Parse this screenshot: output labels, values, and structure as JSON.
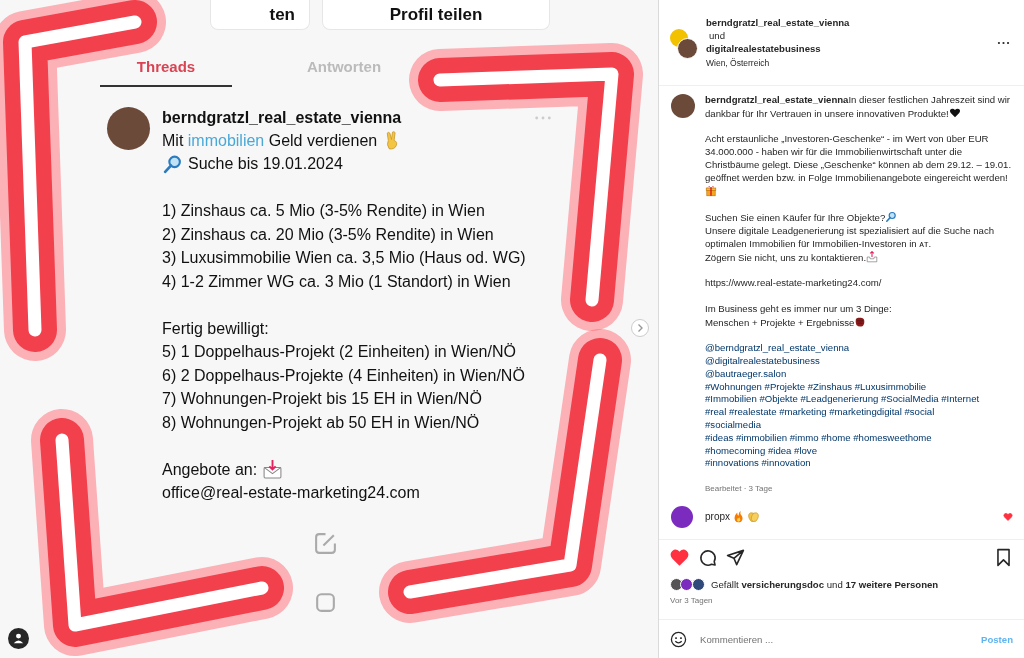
{
  "post_image": {
    "top_buttons": [
      {
        "label": "ten"
      },
      {
        "label": "Profil teilen"
      }
    ],
    "tabs": [
      {
        "label": "Threads",
        "selected": true
      },
      {
        "label": "Antworten",
        "selected": false
      }
    ],
    "thread": {
      "username": "berndgratzl_real_estate_vienna",
      "paragraphs": [
        [
          {
            "before": "Mit ",
            "link": "immobilien",
            "after": " Geld verdienen"
          },
          {
            "text": "Suche bis 19.01.2024"
          }
        ],
        [
          {
            "text": "1) Zinshaus ca. 5 Mio (3-5% Rendite) in Wien"
          },
          {
            "text": "2) Zinshaus ca. 20 Mio (3-5% Rendite) in Wien"
          },
          {
            "text": "3) Luxusimmobilie Wien ca. 3,5 Mio (Haus od. WG)"
          },
          {
            "text": "4) 1-2 Zimmer WG ca. 3 Mio (1 Standort) in Wien"
          }
        ],
        [
          {
            "text": "Fertig bewilligt:"
          },
          {
            "text": "5) 1 Doppelhaus-Projekt (2 Einheiten) in Wien/NÖ"
          },
          {
            "text": "6) 2 Doppelhaus-Projekte (4 Einheiten) in Wien/NÖ"
          },
          {
            "text": "7) Wohnungen-Projekt bis 15 EH in Wien/NÖ"
          },
          {
            "text": "8) Wohnungen-Projekt ab 50 EH in Wien/NÖ"
          }
        ],
        [
          {
            "text": "Angebote an:"
          },
          {
            "text": "office@real-estate-marketing24.com"
          }
        ]
      ]
    }
  },
  "header": {
    "accounts": [
      "berndgratzl_real_estate_vienna",
      "digitalrealestatebusiness"
    ],
    "joiner": "und",
    "location": "Wien, Österreich"
  },
  "caption": {
    "username": "berndgratzl_real_estate_vienna",
    "blocks": [
      [
        {
          "text": "In dieser festlichen Jahreszeit sind wir dankbar für Ihr Vertrauen in unsere innovativen Produkte!",
          "kind": "text"
        }
      ],
      [
        {
          "text": "Acht erstaunliche „Investoren-Geschenke“ - im Wert von über EUR 34.000.000 - haben wir für die Immobilienwirtschaft unter die Christbäume gelegt. Diese „Geschenke“ können ab dem 29.12. – 19.01. geöffnet werden bzw. in Folge Immobilienangebote eingereicht werden!",
          "kind": "text"
        }
      ],
      [
        {
          "text": "Suchen Sie einen Käufer für Ihre Objekte?",
          "kind": "text"
        },
        {
          "text": "Unsere digitale Leadgenerierung ist spezialisiert auf die Suche nach optimalen Immobilien für Immobilien-Investoren in ᴀᴛ.",
          "kind": "text"
        },
        {
          "text": "Zögern Sie nicht, uns zu kontaktieren.",
          "kind": "text"
        }
      ],
      [
        {
          "text": "https://www.real-estate-marketing24.com/",
          "kind": "text"
        }
      ],
      [
        {
          "text": "Im Business geht es immer nur um 3 Dinge:",
          "kind": "text"
        },
        {
          "text": "Menschen + Projekte + Ergebnisse",
          "kind": "text"
        }
      ],
      [
        {
          "text": "@berndgratzl_real_estate_vienna",
          "kind": "tag"
        },
        {
          "text": "@digitalrealestatebusiness",
          "kind": "tag"
        },
        {
          "text": "@bautraeger.salon",
          "kind": "tag"
        },
        {
          "text": "#Wohnungen #Projekte #Zinshaus #Luxusimmobilie",
          "kind": "tag"
        },
        {
          "text": "#Immobilien #Objekte #Leadgenerierung #SocialMedia #Internet",
          "kind": "tag"
        },
        {
          "text": "#real #realestate #marketing #marketingdigital #social",
          "kind": "tag"
        },
        {
          "text": "#socialmedia",
          "kind": "tag"
        },
        {
          "text": "#ideas #immobilien #immo #home #homesweethome",
          "kind": "tag"
        },
        {
          "text": "#homecoming #idea #love",
          "kind": "tag"
        },
        {
          "text": "#innovations #innovation",
          "kind": "tag"
        }
      ]
    ],
    "edited": "Bearbeitet · 3 Tage"
  },
  "comment": {
    "username": "propx",
    "liked": true
  },
  "actions": {
    "liked": true
  },
  "likes": "Gefällt **versicherungsdoc** und **17 weitere Personen**",
  "time": "Vor 3 Tagen",
  "comment_box": {
    "placeholder": "Kommentieren ...",
    "post_button": {
      "label": "Posten",
      "disabled": true
    }
  }
}
